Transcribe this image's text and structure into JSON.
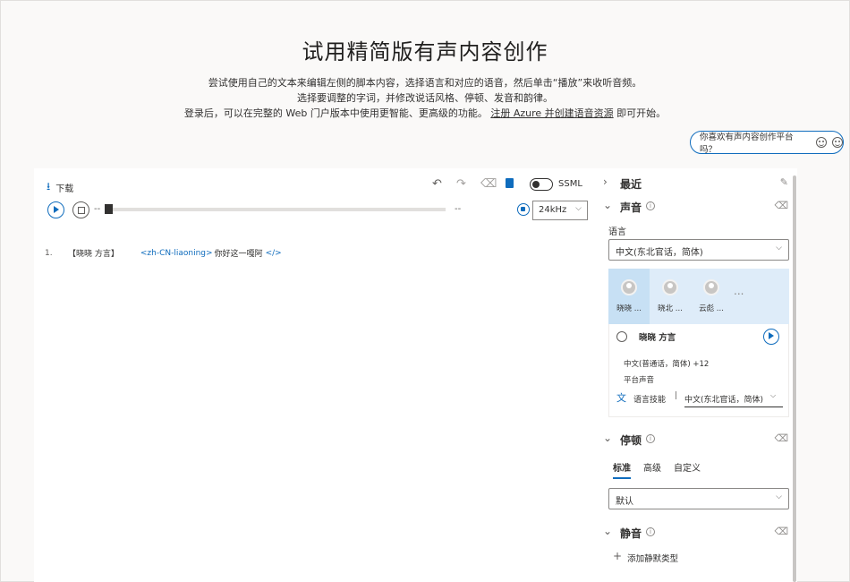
{
  "hero": {
    "title": "试用精简版有声内容创作",
    "line1": "尝试使用自己的文本来编辑左侧的脚本内容，选择语言和对应的语音，然后单击“播放”来收听音频。",
    "line2": "选择要调整的字词，并修改说话风格、停顿、发音和韵律。",
    "line3_prefix": "登录后，可以在完整的 Web 门户版本中使用更智能、更高级的功能。",
    "line3_link": "注册 Azure 并创建语音资源",
    "line3_suffix": " 即可开始。"
  },
  "feedback": {
    "label": "你喜欢有声内容创作平台吗？"
  },
  "toolbar": {
    "download_label": "下载",
    "ssml_label": "SSML"
  },
  "player": {
    "time_current": "--",
    "time_total": "--",
    "sample_rate": "24kHz",
    "progress": 0
  },
  "script": {
    "lines": [
      {
        "number": "1.",
        "speaker": "【晓晓 方言】",
        "tag_open": "<zh-CN-liaoning>",
        "text": "你好这一嘎阿",
        "tag_close": "</>"
      }
    ]
  },
  "panel": {
    "recent": {
      "title": "最近"
    },
    "voice": {
      "title": "声音",
      "language_label": "语言",
      "language_value": "中文(东北官话，简体)",
      "voices": [
        "晓晓 ...",
        "晓北 ...",
        "云彪 ..."
      ],
      "more": "...",
      "selected": {
        "name": "晓晓 方言",
        "languages": "中文(普通话，简体) +12",
        "type": "平台声音",
        "skill_label": "语言技能",
        "skill_sep": "|",
        "skill_value": "中文(东北官话，简体)"
      }
    },
    "pause": {
      "title": "停顿",
      "tabs": [
        "标准",
        "高级",
        "自定义"
      ],
      "value": "默认"
    },
    "silence": {
      "title": "静音",
      "add_label": "添加静默类型"
    }
  },
  "colors": {
    "accent": "#0f6cbd",
    "background": "#faf9f8",
    "selected_voice_bg": "#c7e0f4"
  }
}
